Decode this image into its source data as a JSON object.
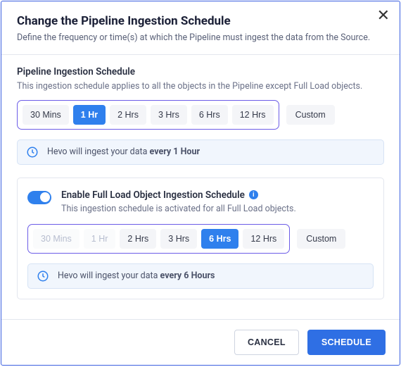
{
  "header": {
    "title": "Change the Pipeline Ingestion Schedule",
    "subtitle": "Define the frequency or time(s) at which the Pipeline must ingest the data from the Source.",
    "close": "✕"
  },
  "schedule": {
    "label": "Pipeline Ingestion Schedule",
    "desc": "This ingestion schedule applies to all the  objects in the Pipeline except Full Load objects.",
    "options": [
      "30 Mins",
      "1 Hr",
      "2 Hrs",
      "3 Hrs",
      "6 Hrs",
      "12 Hrs"
    ],
    "selected": "1 Hr",
    "custom": "Custom",
    "info_prefix": "Hevo will ingest your data ",
    "info_bold": "every 1 Hour"
  },
  "full_load": {
    "toggle_on": true,
    "title": "Enable Full Load Object Ingestion Schedule",
    "desc": "This ingestion schedule is activated for all Full Load objects.",
    "options": [
      "30 Mins",
      "1 Hr",
      "2 Hrs",
      "3 Hrs",
      "6 Hrs",
      "12 Hrs"
    ],
    "disabled": [
      "30 Mins",
      "1 Hr"
    ],
    "selected": "6 Hrs",
    "custom": "Custom",
    "info_prefix": "Hevo will ingest your data ",
    "info_bold": "every 6 Hours"
  },
  "footer": {
    "cancel": "CANCEL",
    "schedule": "SCHEDULE"
  }
}
